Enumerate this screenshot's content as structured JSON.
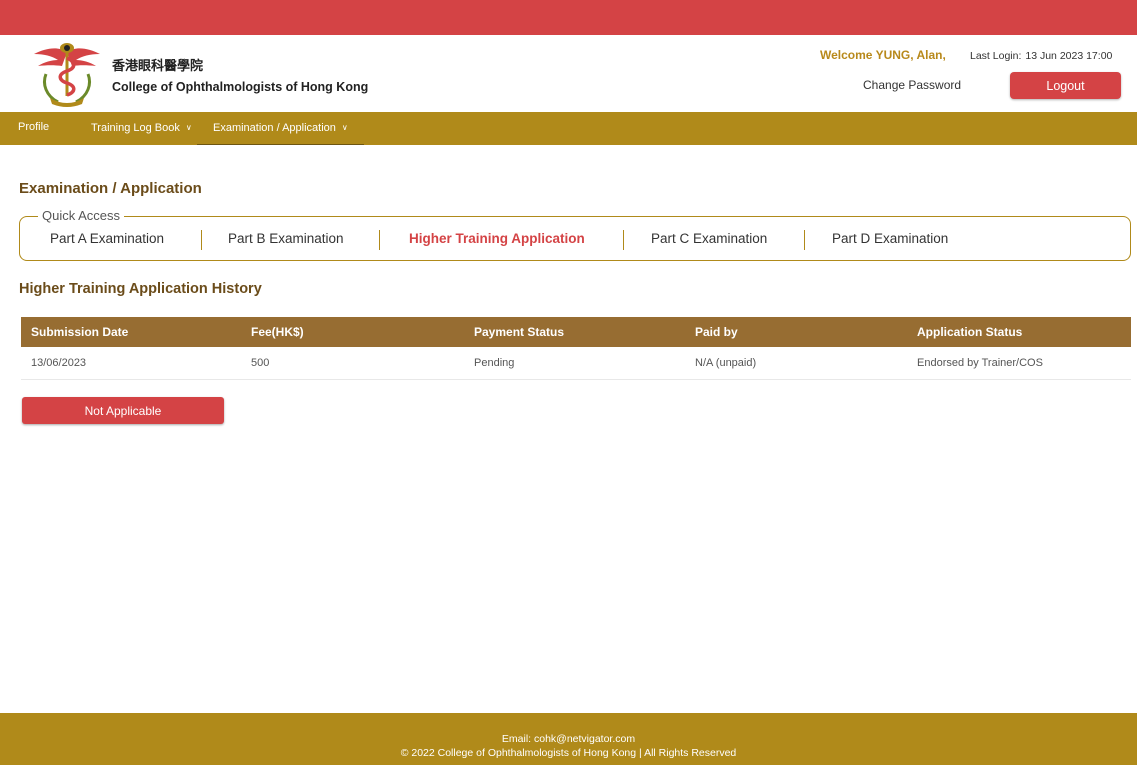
{
  "header": {
    "org_name_cn": "香港眼科醫學院",
    "org_name_en": "College of Ophthalmologists of Hong Kong",
    "welcome_text": "Welcome YUNG, Alan,",
    "last_login_label": "Last Login:",
    "last_login_value": "13 Jun 2023 17:00",
    "change_password_label": "Change Password",
    "logout_label": "Logout"
  },
  "nav": {
    "items": [
      {
        "label": "Profile",
        "has_dropdown": false
      },
      {
        "label": "Training Log Book",
        "has_dropdown": true
      },
      {
        "label": "Examination / Application",
        "has_dropdown": true,
        "active": true
      }
    ]
  },
  "main": {
    "page_title": "Examination / Application",
    "quick_access": {
      "legend": "Quick Access",
      "items": [
        {
          "label": "Part A Examination"
        },
        {
          "label": "Part B Examination"
        },
        {
          "label": "Higher Training Application",
          "active": true
        },
        {
          "label": "Part C Examination"
        },
        {
          "label": "Part D Examination"
        }
      ]
    },
    "history_title": "Higher Training Application History",
    "table": {
      "columns": [
        "Submission Date",
        "Fee(HK$)",
        "Payment Status",
        "Paid by",
        "Application Status"
      ],
      "rows": [
        [
          "13/06/2023",
          "500",
          "Pending",
          "N/A (unpaid)",
          "Endorsed by Trainer/COS"
        ]
      ]
    },
    "not_applicable_label": "Not Applicable"
  },
  "footer": {
    "email_line": "Email: cohk@netvigator.com",
    "copyright_line": "© 2022 College of Ophthalmologists of Hong Kong | All Rights Reserved"
  },
  "colors": {
    "topbar_red": "#d44345",
    "nav_gold": "#b08a1a",
    "table_header_brown": "#976d32",
    "title_brown": "#6b4c1a",
    "active_red": "#d44345"
  },
  "icons": {
    "logo": "college-crest-logo",
    "dropdown": "chevron-down-icon"
  }
}
